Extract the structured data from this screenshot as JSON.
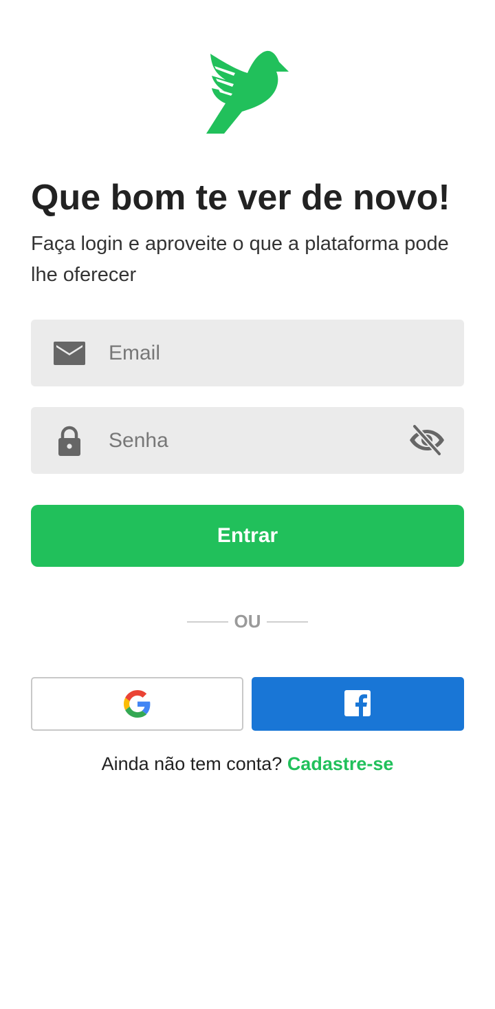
{
  "brand": {
    "logo_icon": "bird-icon",
    "accent_color": "#21c05b"
  },
  "header": {
    "title": "Que bom te ver de novo!",
    "subtitle": "Faça login e aproveite o que a plataforma pode lhe oferecer"
  },
  "form": {
    "email": {
      "icon": "envelope-icon",
      "placeholder": "Email",
      "value": ""
    },
    "password": {
      "icon": "lock-icon",
      "placeholder": "Senha",
      "value": "",
      "toggle_icon": "eye-off-icon"
    },
    "submit_label": "Entrar"
  },
  "divider": {
    "label": "OU"
  },
  "social": {
    "google": {
      "icon": "google-icon",
      "background": "#ffffff"
    },
    "facebook": {
      "icon": "facebook-icon",
      "background": "#1976d6"
    }
  },
  "footer": {
    "prompt": "Ainda não tem conta?",
    "link_label": "Cadastre-se"
  }
}
